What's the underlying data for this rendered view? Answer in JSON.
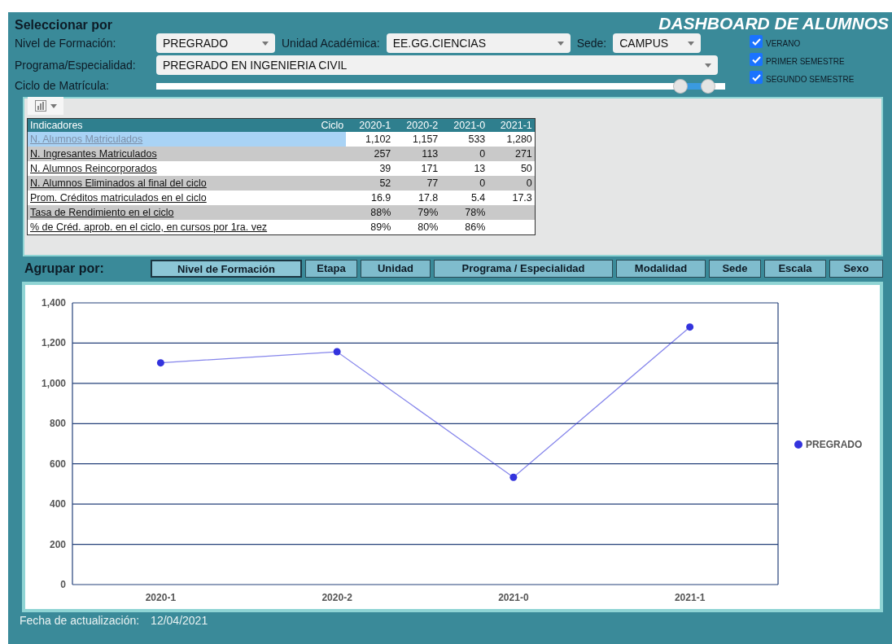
{
  "header": {
    "section_title": "Seleccionar por",
    "title": "DASHBOARD DE ALUMNOS"
  },
  "filters": {
    "nivel": {
      "label": "Nivel de Formación:",
      "value": "PREGRADO"
    },
    "unidad": {
      "label": "Unidad Académica:",
      "value": "EE.GG.CIENCIAS"
    },
    "sede": {
      "label": "Sede:",
      "value": "CAMPUS"
    },
    "programa": {
      "label": "Programa/Especialidad:",
      "value": "PREGRADO EN INGENIERIA CIVIL"
    },
    "ciclo": {
      "label": "Ciclo de Matrícula:",
      "thumbs": [
        {
          "level": 0.95
        },
        {
          "level": 1
        }
      ]
    }
  },
  "checkboxes": [
    {
      "label": "VERANO",
      "checked": true
    },
    {
      "label": "PRIMER SEMESTRE",
      "checked": true
    },
    {
      "label": "SEGUNDO SEMESTRE",
      "checked": true
    }
  ],
  "table": {
    "columns": [
      "Indicadores",
      "Ciclo",
      "2020-1",
      "2020-2",
      "2021-0",
      "2021-1"
    ],
    "rows": [
      {
        "label": "N. Alumnos Matriculados",
        "selected": true,
        "values": [
          "1,102",
          "1,157",
          "533",
          "1,280"
        ]
      },
      {
        "label": "N. Ingresantes Matriculados",
        "selected": false,
        "values": [
          "257",
          "113",
          "0",
          "271"
        ]
      },
      {
        "label": "N. Alumnos Reincorporados",
        "selected": false,
        "values": [
          "39",
          "171",
          "13",
          "50"
        ]
      },
      {
        "label": "N. Alumnos Eliminados al final del ciclo",
        "selected": false,
        "values": [
          "52",
          "77",
          "0",
          "0"
        ]
      },
      {
        "label": "Prom. Créditos matriculados en el ciclo",
        "selected": false,
        "values": [
          "16.9",
          "17.8",
          "5.4",
          "17.3"
        ]
      },
      {
        "label": "Tasa de Rendimiento en el ciclo",
        "selected": false,
        "values": [
          "88%",
          "79%",
          "78%"
        ]
      },
      {
        "label": "% de Créd. aprob. en el ciclo, en cursos por 1ra. vez",
        "selected": false,
        "values": [
          "89%",
          "80%",
          "86%"
        ]
      }
    ]
  },
  "group_by": {
    "label": "Agrupar por:",
    "tabs": [
      {
        "label": "Nivel de Formación",
        "selected": true
      },
      {
        "label": "Etapa",
        "selected": false
      },
      {
        "label": "Unidad",
        "selected": false
      },
      {
        "label": "Programa / Especialidad",
        "selected": false
      },
      {
        "label": "Modalidad",
        "selected": false
      },
      {
        "label": "Sede",
        "selected": false
      },
      {
        "label": "Escala",
        "selected": false
      },
      {
        "label": "Sexo",
        "selected": false
      }
    ]
  },
  "chart": {
    "chart_data": {
      "type": "line",
      "categories": [
        "2020-1",
        "2020-2",
        "2021-0",
        "2021-1"
      ],
      "series": [
        {
          "name": "PREGRADO",
          "color": "#3333dd",
          "marker": "circle",
          "values": [
            1102,
            1157,
            533,
            1280
          ]
        }
      ],
      "grid": true,
      "ylim": [
        0,
        1400
      ],
      "yticks": [
        0,
        {
          "value": 200,
          "label": "200"
        },
        {
          "value": 400,
          "label": "400"
        },
        {
          "value": 600,
          "label": "600"
        },
        {
          "value": 800,
          "label": "800"
        },
        {
          "value": 1000,
          "label": "1,000"
        },
        {
          "value": 1200,
          "label": "1,200"
        },
        {
          "value": 1400,
          "label": "1,400"
        }
      ]
    }
  },
  "footer": {
    "label": "Fecha de actualización:",
    "value": "12/04/2021"
  }
}
